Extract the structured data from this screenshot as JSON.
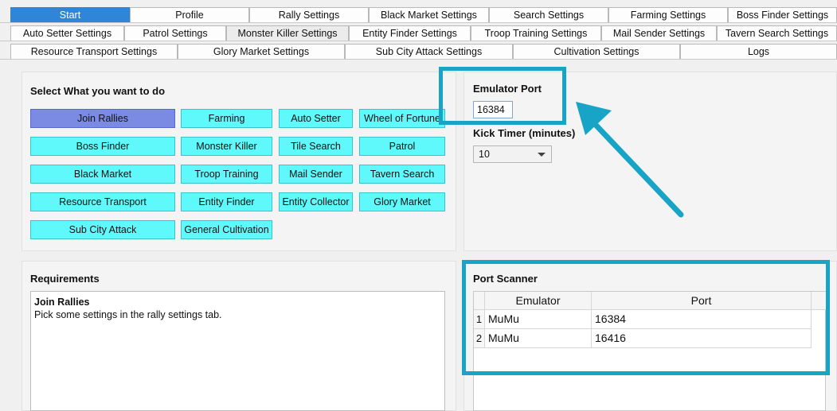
{
  "tabs": {
    "row1": [
      "Start",
      "Profile",
      "Rally Settings",
      "Black Market Settings",
      "Search Settings",
      "Farming Settings",
      "Boss Finder Settings"
    ],
    "row2": [
      "Auto Setter Settings",
      "Patrol Settings",
      "Monster Killer Settings",
      "Entity Finder Settings",
      "Troop Training Settings",
      "Mail Sender Settings",
      "Tavern Search Settings"
    ],
    "row3": [
      "Resource Transport Settings",
      "Glory Market Settings",
      "Sub City Attack Settings",
      "Cultivation Settings",
      "Logs"
    ],
    "active": "Start"
  },
  "select_panel": {
    "heading": "Select What you want to do",
    "buttons": [
      "Join Rallies",
      "Farming",
      "Auto Setter",
      "Wheel of Fortune",
      "Boss Finder",
      "Monster Killer",
      "Tile Search",
      "Patrol",
      "Black Market",
      "Troop Training",
      "Mail Sender",
      "Tavern Search",
      "Resource Transport",
      "Entity Finder",
      "Entity Collector",
      "Glory Market",
      "Sub City Attack",
      "General Cultivation"
    ],
    "selected": "Join Rallies"
  },
  "emulator": {
    "port_label": "Emulator Port",
    "port_value": "16384",
    "kick_label": "Kick Timer (minutes)",
    "kick_value": "10"
  },
  "requirements": {
    "heading": "Requirements",
    "title": "Join Rallies",
    "text": "Pick some settings in the rally settings tab."
  },
  "port_scanner": {
    "heading": "Port Scanner",
    "columns": [
      "Emulator",
      "Port"
    ],
    "rows": [
      {
        "index": "1",
        "emulator": "MuMu",
        "port": "16384"
      },
      {
        "index": "2",
        "emulator": "MuMu",
        "port": "16416"
      }
    ]
  },
  "colors": {
    "accent_tab": "#2f86d8",
    "button_cyan": "#5ff9fb",
    "button_selected": "#7b8ae3",
    "annotation": "#17a4c6"
  }
}
